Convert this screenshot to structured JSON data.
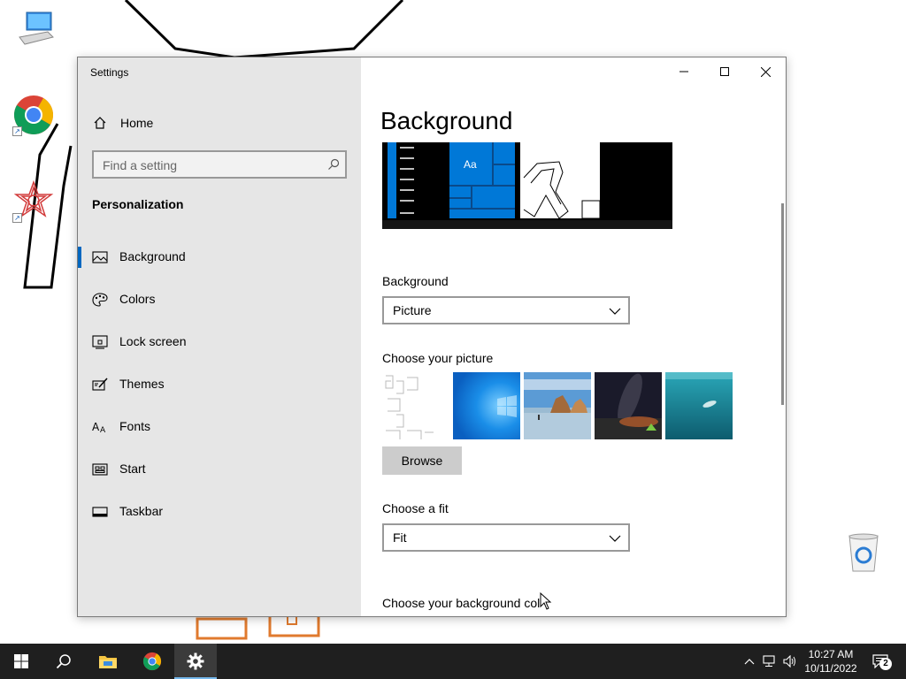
{
  "desktop": {
    "icons": [
      {
        "name": "this-pc"
      },
      {
        "name": "google-chrome",
        "shortcut": true
      },
      {
        "name": "mathematica",
        "shortcut": true
      },
      {
        "name": "recycle-bin"
      }
    ]
  },
  "window": {
    "title": "Settings",
    "controls": {
      "minimize": "minimize-icon",
      "maximize": "maximize-icon",
      "close": "close-icon"
    }
  },
  "nav": {
    "home_label": "Home",
    "search_placeholder": "Find a setting",
    "section_title": "Personalization",
    "selected": "Background",
    "items": [
      {
        "label": "Background",
        "icon": "picture-icon"
      },
      {
        "label": "Colors",
        "icon": "palette-icon"
      },
      {
        "label": "Lock screen",
        "icon": "lock-screen-icon"
      },
      {
        "label": "Themes",
        "icon": "themes-icon"
      },
      {
        "label": "Fonts",
        "icon": "fonts-icon"
      },
      {
        "label": "Start",
        "icon": "start-icon"
      },
      {
        "label": "Taskbar",
        "icon": "taskbar-icon"
      }
    ]
  },
  "main": {
    "page_title": "Background",
    "preview_sample_text": "Aa",
    "background_label": "Background",
    "background_value": "Picture",
    "choose_picture_label": "Choose your picture",
    "browse_label": "Browse",
    "fit_label": "Choose a fit",
    "fit_value": "Fit",
    "bg_color_label": "Choose your background col"
  },
  "taskbar": {
    "apps": [
      "start-icon",
      "search-icon",
      "file-explorer-icon",
      "chrome-icon",
      "settings-icon"
    ],
    "active_app": "settings-icon",
    "time": "10:27 AM",
    "date": "10/11/2022",
    "notification_count": "2"
  },
  "colors": {
    "accent": "#0067c0",
    "tile_blue": "#0078d7",
    "taskbar": "#1f1f1f",
    "nav_bg": "#e6e6e6"
  }
}
